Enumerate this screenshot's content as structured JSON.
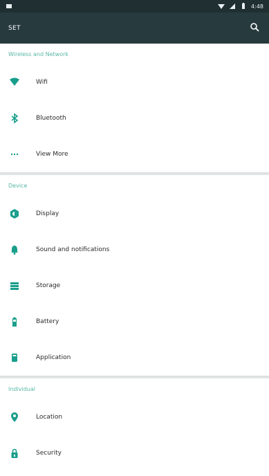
{
  "status_bar": {
    "time": "4:48",
    "icons": [
      "notification-icon",
      "wifi-icon",
      "cell-signal-icon",
      "battery-icon"
    ]
  },
  "top_bar": {
    "title": "SET",
    "search_icon": "search-icon"
  },
  "sections": {
    "wireless": {
      "header": "Wireless and Network",
      "items": [
        {
          "label": "Wifi",
          "icon": "wifi-icon"
        },
        {
          "label": "Bluetooth",
          "icon": "bluetooth-icon"
        },
        {
          "label": "View More",
          "icon": "more-icon"
        }
      ]
    },
    "device": {
      "header": "Device",
      "items": [
        {
          "label": "Display",
          "icon": "display-icon"
        },
        {
          "label": "Sound and notifications",
          "icon": "bell-icon"
        },
        {
          "label": "Storage",
          "icon": "storage-icon"
        },
        {
          "label": "Battery",
          "icon": "battery-icon"
        },
        {
          "label": "Application",
          "icon": "application-icon"
        }
      ]
    },
    "individual": {
      "header": "Individual",
      "items": [
        {
          "label": "Location",
          "icon": "location-icon"
        },
        {
          "label": "Security",
          "icon": "lock-icon"
        }
      ]
    }
  },
  "colors": {
    "accent": "#189e8b",
    "header_text": "#58b7a5",
    "appbar": "#273a3e",
    "statusbar": "#1f2f32",
    "divider": "#e1e4e5"
  }
}
